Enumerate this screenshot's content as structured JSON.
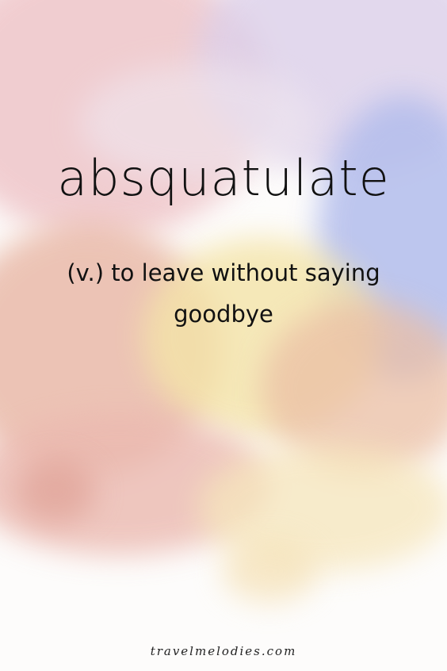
{
  "word": "absquatulate",
  "definition": "(v.) to leave without saying goodbye",
  "footer": "travelmelodies.com",
  "colors": {
    "pink": "#eab3b4",
    "peach": "#e9b49a",
    "yellow": "#f4e2a6",
    "lavender": "#c9c5ea",
    "blue": "#a9b7ec"
  }
}
